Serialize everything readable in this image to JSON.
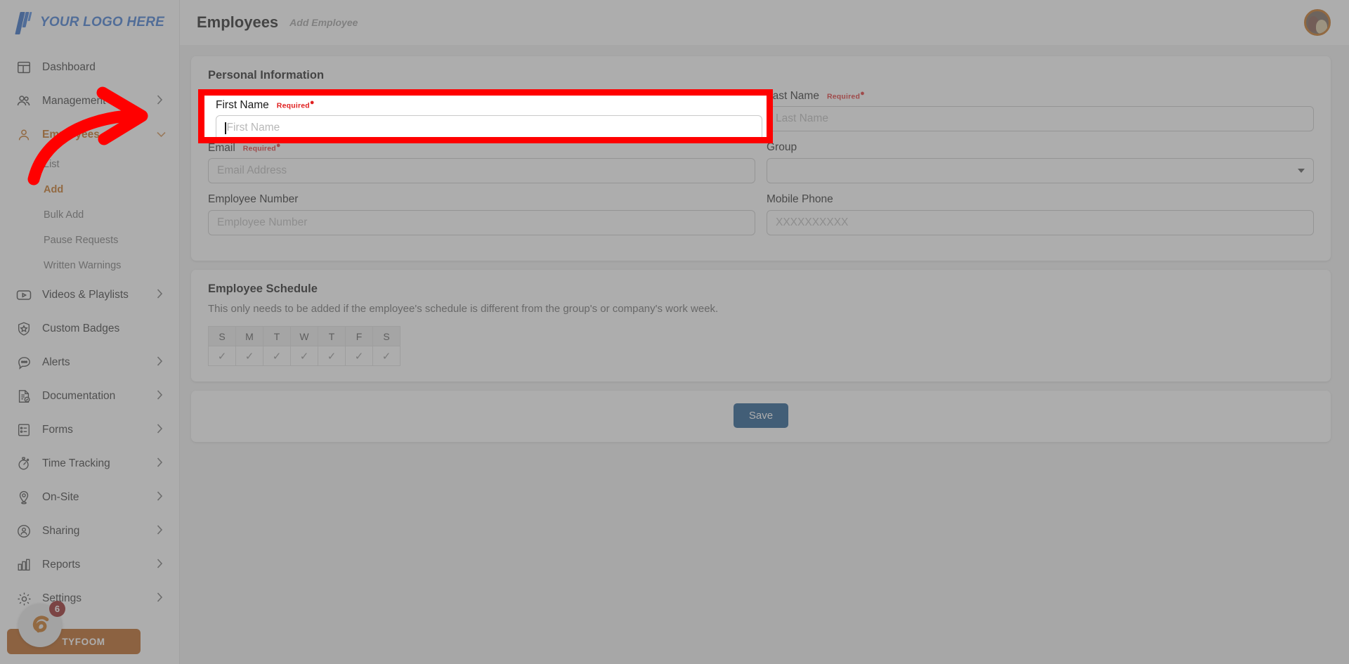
{
  "brand": {
    "logo_text": "YOUR LOGO HERE",
    "logo_color": "#2f6fd0",
    "accent_color": "#c2650a",
    "primary_color": "#0d4b85",
    "highlight_color": "#ff0000"
  },
  "sidebar": {
    "items": [
      {
        "label": "Dashboard",
        "icon": "dashboard-icon",
        "chevron": false,
        "active": false
      },
      {
        "label": "Management",
        "icon": "users-icon",
        "chevron": true,
        "active": false
      },
      {
        "label": "Employees",
        "icon": "user-icon",
        "chevron": true,
        "active": true
      },
      {
        "label": "Videos & Playlists",
        "icon": "video-icon",
        "chevron": true,
        "active": false
      },
      {
        "label": "Custom Badges",
        "icon": "badge-icon",
        "chevron": false,
        "active": false
      },
      {
        "label": "Alerts",
        "icon": "alert-chat-icon",
        "chevron": true,
        "active": false
      },
      {
        "label": "Documentation",
        "icon": "document-icon",
        "chevron": true,
        "active": false
      },
      {
        "label": "Forms",
        "icon": "forms-icon",
        "chevron": true,
        "active": false
      },
      {
        "label": "Time Tracking",
        "icon": "stopwatch-icon",
        "chevron": true,
        "active": false
      },
      {
        "label": "On-Site",
        "icon": "map-pin-icon",
        "chevron": true,
        "active": false
      },
      {
        "label": "Sharing",
        "icon": "share-user-icon",
        "chevron": true,
        "active": false
      },
      {
        "label": "Reports",
        "icon": "bar-chart-icon",
        "chevron": true,
        "active": false
      },
      {
        "label": "Settings",
        "icon": "gear-icon",
        "chevron": true,
        "active": false
      }
    ],
    "employees_subitems": [
      {
        "label": "List",
        "active": false
      },
      {
        "label": "Add",
        "active": true
      },
      {
        "label": "Bulk Add",
        "active": false
      },
      {
        "label": "Pause Requests",
        "active": false
      },
      {
        "label": "Written Warnings",
        "active": false
      }
    ],
    "promo": {
      "label": "TYFOOM",
      "badge_count": "6"
    }
  },
  "header": {
    "title": "Employees",
    "breadcrumb": "Add Employee"
  },
  "personal_information": {
    "section_title": "Personal Information",
    "required_label": "Required",
    "fields": {
      "first_name": {
        "label": "First Name",
        "placeholder": "First Name",
        "value": "",
        "required": true,
        "focused": true
      },
      "last_name": {
        "label": "Last Name",
        "placeholder": "Last Name",
        "value": "",
        "required": true
      },
      "email": {
        "label": "Email",
        "placeholder": "Email Address",
        "value": "",
        "required": true
      },
      "group": {
        "label": "Group",
        "placeholder": "",
        "value": "",
        "required": false,
        "type": "select"
      },
      "employee_number": {
        "label": "Employee Number",
        "placeholder": "Employee Number",
        "value": "",
        "required": false
      },
      "mobile_phone": {
        "label": "Mobile Phone",
        "placeholder": "XXXXXXXXXX",
        "value": "",
        "required": false
      }
    }
  },
  "employee_schedule": {
    "section_title": "Employee Schedule",
    "description": "This only needs to be added if the employee's schedule is different from the group's or company's work week.",
    "days": [
      "S",
      "M",
      "T",
      "W",
      "T",
      "F",
      "S"
    ],
    "checked": [
      true,
      true,
      true,
      true,
      true,
      true,
      true
    ],
    "check_glyph": "✓"
  },
  "footer": {
    "save_label": "Save"
  },
  "annotation": {
    "type": "curved-arrow",
    "color": "#ff0000",
    "highlight_target": "first-name-field",
    "highlight_border_color": "#ff0000"
  }
}
